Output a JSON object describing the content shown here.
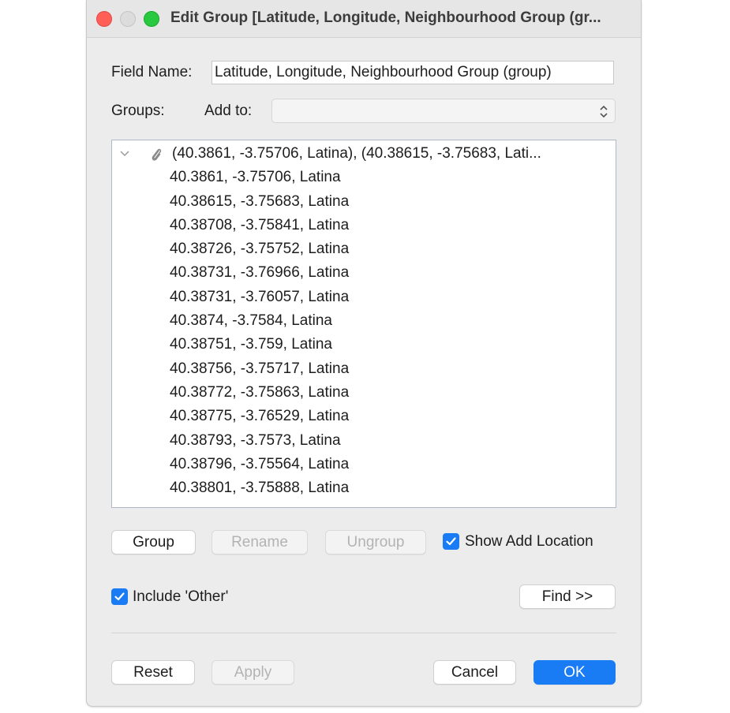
{
  "window": {
    "title": "Edit Group [Latitude, Longitude, Neighbourhood Group (gr..."
  },
  "field_name": {
    "label": "Field Name:",
    "value": "Latitude, Longitude, Neighbourhood Group (group)"
  },
  "groups": {
    "label": "Groups:",
    "add_to_label": "Add to:",
    "add_to_value": ""
  },
  "list": {
    "group_label": "(40.3861, -3.75706, Latina), (40.38615, -3.75683, Lati...",
    "items": [
      "40.3861, -3.75706, Latina",
      "40.38615, -3.75683, Latina",
      "40.38708, -3.75841, Latina",
      "40.38726, -3.75752, Latina",
      "40.38731, -3.76966, Latina",
      "40.38731, -3.76057, Latina",
      "40.3874, -3.7584, Latina",
      "40.38751, -3.759, Latina",
      "40.38756, -3.75717, Latina",
      "40.38772, -3.75863, Latina",
      "40.38775, -3.76529, Latina",
      "40.38793, -3.7573, Latina",
      "40.38796, -3.75564, Latina",
      "40.38801, -3.75888, Latina"
    ]
  },
  "buttons": {
    "group": "Group",
    "rename": "Rename",
    "ungroup": "Ungroup",
    "find": "Find >>",
    "reset": "Reset",
    "apply": "Apply",
    "cancel": "Cancel",
    "ok": "OK"
  },
  "options": {
    "show_add_location": {
      "label": "Show Add Location",
      "checked": true
    },
    "include_other": {
      "label": "Include 'Other'",
      "checked": true
    }
  },
  "colors": {
    "accent": "#1a7cf5",
    "close": "#ff5f57",
    "zoom": "#28c840"
  }
}
